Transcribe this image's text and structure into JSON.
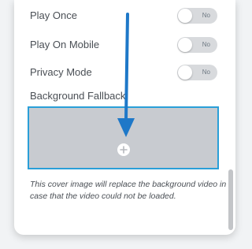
{
  "settings": {
    "rows": [
      {
        "label": "Play Once",
        "toggle_text": "No"
      },
      {
        "label": "Play On Mobile",
        "toggle_text": "No"
      },
      {
        "label": "Privacy Mode",
        "toggle_text": "No"
      }
    ],
    "background_fallback": {
      "label": "Background Fallback",
      "add_icon": "plus-icon",
      "help_text": "This cover image will replace the background video in case that the video could not be loaded."
    }
  },
  "colors": {
    "accent": "#2a9fd8",
    "arrow": "#1e78c8",
    "panel": "#ffffff",
    "media_placeholder": "#c8cbd0",
    "text": "#4a4f55",
    "toggle_off": "#d8dadd"
  }
}
